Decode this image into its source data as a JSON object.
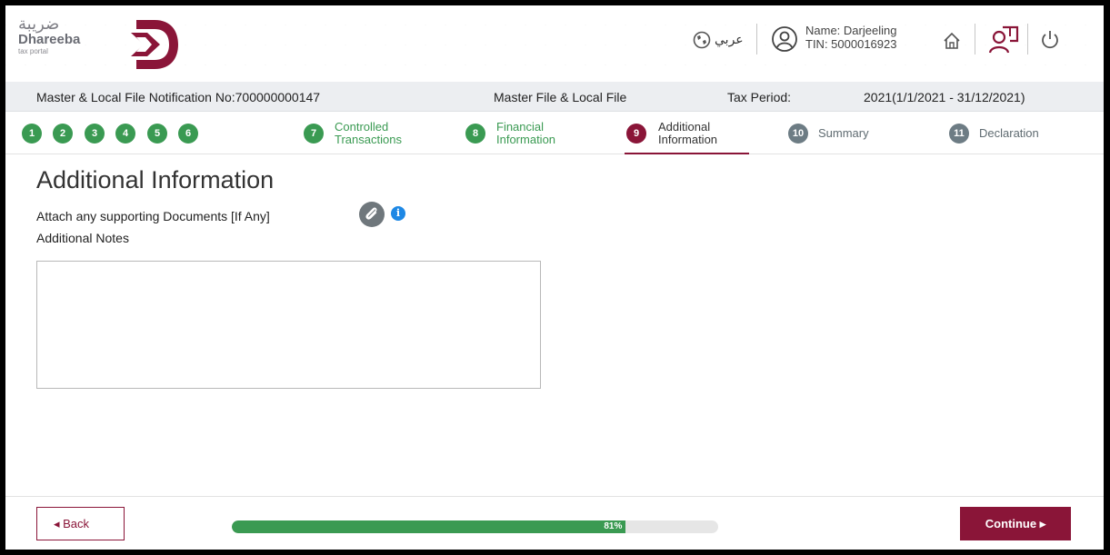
{
  "header": {
    "logo_arabic": "ضريبة",
    "logo_name": "Dhareeba",
    "logo_sub": "tax portal",
    "language_link": "عربي",
    "user_name": "Name: Darjeeling",
    "user_tin": "TIN: 5000016923",
    "icons": [
      "globe-icon",
      "user-icon",
      "home-icon",
      "user-book-icon",
      "power-icon"
    ]
  },
  "infobar": {
    "notification": "Master & Local File Notification No:700000000147",
    "file_type": "Master File & Local File",
    "tax_period_label": "Tax Period:",
    "tax_period_value": "2021(1/1/2021 - 31/12/2021)"
  },
  "stepper": {
    "steps": [
      {
        "num": "1",
        "state": "done"
      },
      {
        "num": "2",
        "state": "done"
      },
      {
        "num": "3",
        "state": "done"
      },
      {
        "num": "4",
        "state": "done"
      },
      {
        "num": "5",
        "state": "done"
      },
      {
        "num": "6",
        "state": "done"
      },
      {
        "num": "7",
        "state": "done",
        "line1": "Controlled",
        "line2": "Transactions"
      },
      {
        "num": "8",
        "state": "done",
        "line1": "Financial",
        "line2": "Information"
      },
      {
        "num": "9",
        "state": "active",
        "line1": "Additional",
        "line2": "Information"
      },
      {
        "num": "10",
        "state": "todo",
        "line1": "Summary"
      },
      {
        "num": "11",
        "state": "todo",
        "line1": "Declaration"
      }
    ]
  },
  "main": {
    "title": "Additional Information",
    "attach_label": "Attach any supporting Documents [If Any]",
    "notes_label": "Additional Notes",
    "notes_value": ""
  },
  "footer": {
    "back_label": "◂  Back",
    "continue_label": "Continue  ▸",
    "progress_percent": 81,
    "progress_text": "81%"
  },
  "colors": {
    "brand": "#8a1538",
    "success": "#3a9a52",
    "pending": "#6d7c84",
    "info": "#1e88e5"
  }
}
